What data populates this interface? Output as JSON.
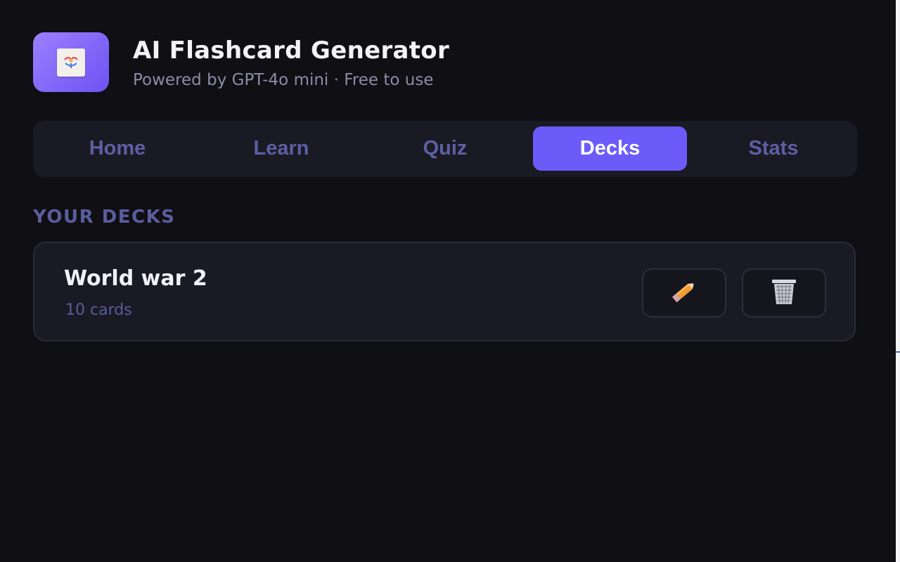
{
  "app": {
    "title": "AI Flashcard Generator",
    "subtitle": "Powered by GPT-4o mini · Free to use",
    "icon": "flashcard-app-icon"
  },
  "tabs": [
    {
      "label": "Home",
      "active": false
    },
    {
      "label": "Learn",
      "active": false
    },
    {
      "label": "Quiz",
      "active": false
    },
    {
      "label": "Decks",
      "active": true
    },
    {
      "label": "Stats",
      "active": false
    }
  ],
  "decks_section": {
    "label": "YOUR DECKS",
    "decks": [
      {
        "name": "World war 2",
        "count": "10 cards",
        "edit_icon": "pencil-icon",
        "delete_icon": "wastebasket-icon"
      }
    ]
  },
  "colors": {
    "background": "#0f0f14",
    "surface": "#1a1a24",
    "accent": "#6b5cfa",
    "muted_text": "#5a5c9c"
  }
}
